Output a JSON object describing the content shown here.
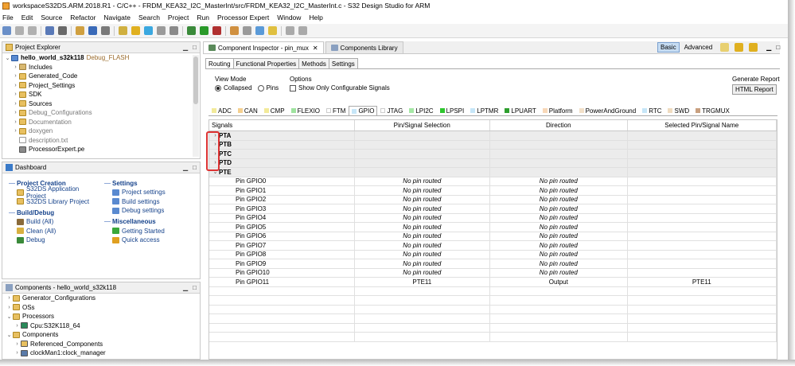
{
  "window": {
    "title": "workspaceS32DS.ARM.2018.R1 - C/C++ - FRDM_KEA32_I2C_MasterInt/src/FRDM_KEA32_I2C_MasterInt.c - S32 Design Studio for ARM"
  },
  "menu": [
    "File",
    "Edit",
    "Source",
    "Refactor",
    "Navigate",
    "Search",
    "Project",
    "Run",
    "Processor Expert",
    "Window",
    "Help"
  ],
  "project_explorer": {
    "title": "Project Explorer",
    "root": {
      "name": "hello_world_s32k118",
      "suffix": "Debug_FLASH"
    },
    "items": [
      {
        "label": "Includes",
        "kind": "pkg",
        "muted": false
      },
      {
        "label": "Generated_Code",
        "kind": "folder",
        "muted": false
      },
      {
        "label": "Project_Settings",
        "kind": "folder",
        "muted": false
      },
      {
        "label": "SDK",
        "kind": "folder",
        "muted": false
      },
      {
        "label": "Sources",
        "kind": "folder",
        "muted": false
      },
      {
        "label": "Debug_Configurations",
        "kind": "folder",
        "muted": true
      },
      {
        "label": "Documentation",
        "kind": "folder",
        "muted": true
      },
      {
        "label": "doxygen",
        "kind": "folder",
        "muted": true
      },
      {
        "label": "description.txt",
        "kind": "file",
        "muted": true
      },
      {
        "label": "ProcessorExpert.pe",
        "kind": "pe",
        "muted": false
      }
    ]
  },
  "dashboard": {
    "title": "Dashboard",
    "project_creation": {
      "title": "Project Creation",
      "items": [
        "S32DS Application Project",
        "S32DS Library Project"
      ]
    },
    "build_debug": {
      "title": "Build/Debug",
      "items": [
        "Build   (All)",
        "Clean   (All)",
        "Debug"
      ]
    },
    "settings": {
      "title": "Settings",
      "items": [
        "Project settings",
        "Build settings",
        "Debug settings"
      ]
    },
    "misc": {
      "title": "Miscellaneous",
      "items": [
        "Getting Started",
        "Quick access"
      ]
    }
  },
  "components": {
    "title": "Components - hello_world_s32k118",
    "items": [
      {
        "label": "Generator_Configurations",
        "indent": 1
      },
      {
        "label": "OSs",
        "indent": 1
      },
      {
        "label": "Processors",
        "indent": 1
      },
      {
        "label": "Cpu:S32K118_64",
        "indent": 2
      },
      {
        "label": "Components",
        "indent": 1
      },
      {
        "label": "Referenced_Components",
        "indent": 2
      },
      {
        "label": "clockMan1:clock_manager",
        "indent": 2
      }
    ]
  },
  "editor": {
    "tabs": [
      "Component Inspector - pin_mux",
      "Components Library"
    ],
    "mode_buttons": [
      "Basic",
      "Advanced"
    ],
    "sub_tabs": [
      "Routing",
      "Functional Properties",
      "Methods",
      "Settings"
    ],
    "view_mode": {
      "label": "View Mode",
      "options": [
        "Collapsed",
        "Pins"
      ],
      "selected": "Collapsed"
    },
    "options": {
      "label": "Options",
      "checkbox": "Show Only Configurable Signals",
      "checked": false
    },
    "report": {
      "label": "Generate Report",
      "button": "HTML Report"
    },
    "peripherals": [
      {
        "name": "ADC",
        "color": "#f2ea9a"
      },
      {
        "name": "CAN",
        "color": "#f5d090"
      },
      {
        "name": "CMP",
        "color": "#f2ea9a"
      },
      {
        "name": "FLEXIO",
        "color": "#9fe39f"
      },
      {
        "name": "FTM",
        "color": "#ffffff"
      },
      {
        "name": "GPIO",
        "color": "#c6e6f8"
      },
      {
        "name": "JTAG",
        "color": "#ffffff"
      },
      {
        "name": "LPI2C",
        "color": "#a5e8a5"
      },
      {
        "name": "LPSPI",
        "color": "#2ec62e"
      },
      {
        "name": "LPTMR",
        "color": "#c6e6f8"
      },
      {
        "name": "LPUART",
        "color": "#2e9e2e"
      },
      {
        "name": "Platform",
        "color": "#f8d8b8"
      },
      {
        "name": "PowerAndGround",
        "color": "#f2e0c8"
      },
      {
        "name": "RTC",
        "color": "#c6e6f8"
      },
      {
        "name": "SWD",
        "color": "#f0dcc0"
      },
      {
        "name": "TRGMUX",
        "color": "#c8a080"
      }
    ],
    "active_peripheral": "GPIO",
    "columns": [
      "Signals",
      "Pin/Signal Selection",
      "Direction",
      "Selected Pin/Signal Name"
    ],
    "groups": [
      "PTA",
      "PTB",
      "PTC",
      "PTD",
      "PTE"
    ],
    "rows": [
      {
        "signal": "Pin GPIO0",
        "pin": "No pin routed",
        "dir": "No pin routed",
        "sel": ""
      },
      {
        "signal": "Pin GPIO1",
        "pin": "No pin routed",
        "dir": "No pin routed",
        "sel": ""
      },
      {
        "signal": "Pin GPIO2",
        "pin": "No pin routed",
        "dir": "No pin routed",
        "sel": ""
      },
      {
        "signal": "Pin GPIO3",
        "pin": "No pin routed",
        "dir": "No pin routed",
        "sel": ""
      },
      {
        "signal": "Pin GPIO4",
        "pin": "No pin routed",
        "dir": "No pin routed",
        "sel": ""
      },
      {
        "signal": "Pin GPIO5",
        "pin": "No pin routed",
        "dir": "No pin routed",
        "sel": ""
      },
      {
        "signal": "Pin GPIO6",
        "pin": "No pin routed",
        "dir": "No pin routed",
        "sel": ""
      },
      {
        "signal": "Pin GPIO7",
        "pin": "No pin routed",
        "dir": "No pin routed",
        "sel": ""
      },
      {
        "signal": "Pin GPIO8",
        "pin": "No pin routed",
        "dir": "No pin routed",
        "sel": ""
      },
      {
        "signal": "Pin GPIO9",
        "pin": "No pin routed",
        "dir": "No pin routed",
        "sel": ""
      },
      {
        "signal": "Pin GPIO10",
        "pin": "No pin routed",
        "dir": "No pin routed",
        "sel": ""
      },
      {
        "signal": "Pin GPIO11",
        "pin": "PTE11",
        "dir": "Output",
        "sel": "PTE11"
      }
    ]
  },
  "colors": {
    "link": "#15428b",
    "highlight": "#dd3333",
    "mode_active": "#c6dcf2"
  }
}
